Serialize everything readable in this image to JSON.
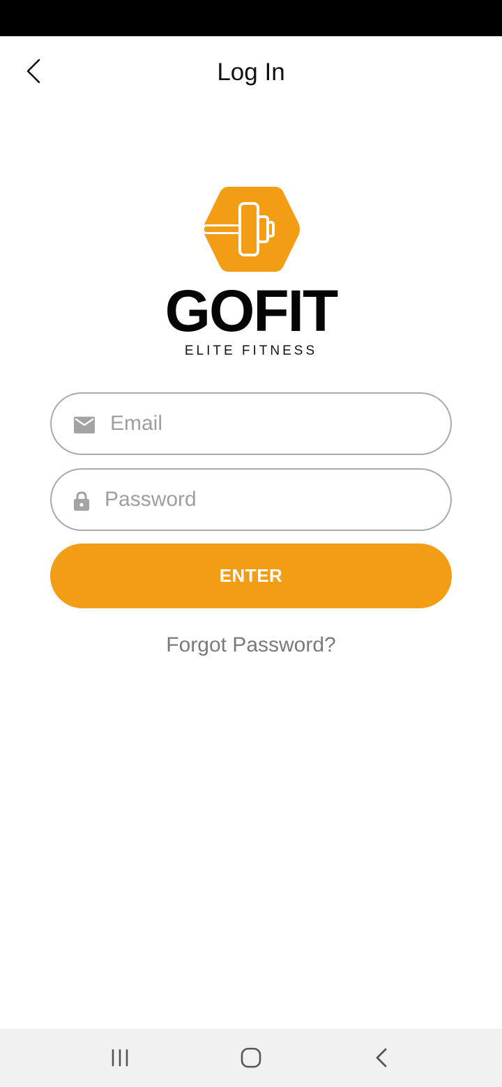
{
  "header": {
    "title": "Log In",
    "back_icon": "chevron-left-icon"
  },
  "logo": {
    "wordmark": "GOFIT",
    "tagline": "ELITE FITNESS",
    "icon": "dumbbell-hexagon-icon"
  },
  "form": {
    "email": {
      "placeholder": "Email",
      "value": "",
      "icon": "mail-icon"
    },
    "password": {
      "placeholder": "Password",
      "value": "",
      "icon": "lock-icon"
    },
    "enter_label": "ENTER",
    "forgot_label": "Forgot Password?"
  },
  "system_nav": {
    "recents_icon": "recents-icon",
    "home_icon": "home-icon",
    "back_icon": "back-icon"
  },
  "colors": {
    "accent": "#f29d14",
    "status_bar": "#000000",
    "nav_bar": "#f1f1f1",
    "field_border": "#a9a9a9",
    "placeholder": "#9e9e9e",
    "link": "#7a7a7a"
  }
}
